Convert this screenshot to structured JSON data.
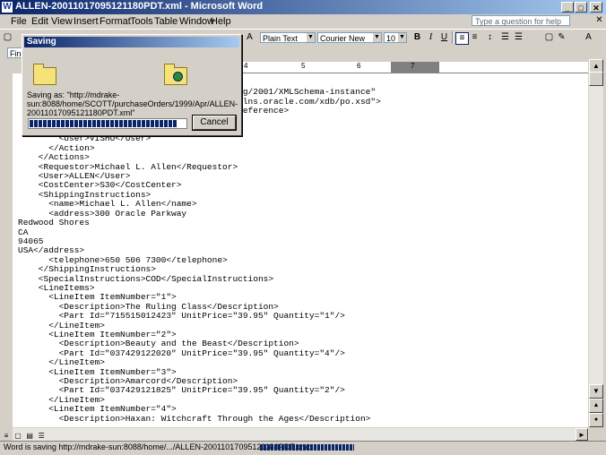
{
  "window": {
    "title": "ALLEN-20011017095121180PDT.xml - Microsoft Word",
    "icon": "W"
  },
  "menu": [
    "File",
    "Edit",
    "View",
    "Insert",
    "Format",
    "Tools",
    "Table",
    "Window",
    "Help"
  ],
  "help_box": {
    "placeholder": "Type a question for help"
  },
  "toolbar": {
    "style": "Plain Text",
    "font": "Courier New",
    "size": "10",
    "bold": "B",
    "italic": "I",
    "underline": "U",
    "style2_partial": "Fina"
  },
  "ruler": {
    "marks": [
      "4",
      "5",
      "6",
      "7"
    ]
  },
  "dialog": {
    "title": "Saving",
    "saving_as": "Saving as: \"http://mdrake-sun:8088/home/SCOTT/purchaseOrders/1999/Apr/ALLEN-20011017095121180PDT.xml\"",
    "progress": 0.96,
    "cancel": "Cancel"
  },
  "document": {
    "text": "  <?xml version=\"1.0\"?>\n  <PurchaseOrder xmlns:xsi=\"http://www.w3.org/2001/XMLSchema-instance\"\n    xsi:noNamespaceSchemaLocation=\"http://xmlns.oracle.com/xdb/po.xsd\">\n    <Reference>ALLEN-20011017095121180PDT</Reference>\n    <Actions>\n      <Action>\n        <User>VISHU</User>\n      </Action>\n    </Actions>\n    <Requestor>Michael L. Allen</Requestor>\n    <User>ALLEN</User>\n    <CostCenter>S30</CostCenter>\n    <ShippingInstructions>\n      <name>Michael L. Allen</name>\n      <address>300 Oracle Parkway\nRedwood Shores\nCA\n94065\nUSA</address>\n      <telephone>650 506 7300</telephone>\n    </ShippingInstructions>\n    <SpecialInstructions>COD</SpecialInstructions>\n    <LineItems>\n      <LineItem ItemNumber=\"1\">\n        <Description>The Ruling Class</Description>\n        <Part Id=\"715515012423\" UnitPrice=\"39.95\" Quantity=\"1\"/>\n      </LineItem>\n      <LineItem ItemNumber=\"2\">\n        <Description>Beauty and the Beast</Description>\n        <Part Id=\"037429122020\" UnitPrice=\"39.95\" Quantity=\"4\"/>\n      </LineItem>\n      <LineItem ItemNumber=\"3\">\n        <Description>Amarcord</Description>\n        <Part Id=\"037429121825\" UnitPrice=\"39.95\" Quantity=\"2\"/>\n      </LineItem>\n      <LineItem ItemNumber=\"4\">\n        <Description>Haxan: Witchcraft Through the Ages</Description>"
  },
  "status": {
    "text": "Word is saving http://mdrake-sun:8088/home/.../ALLEN-20011017095121180PDT.xml:"
  }
}
